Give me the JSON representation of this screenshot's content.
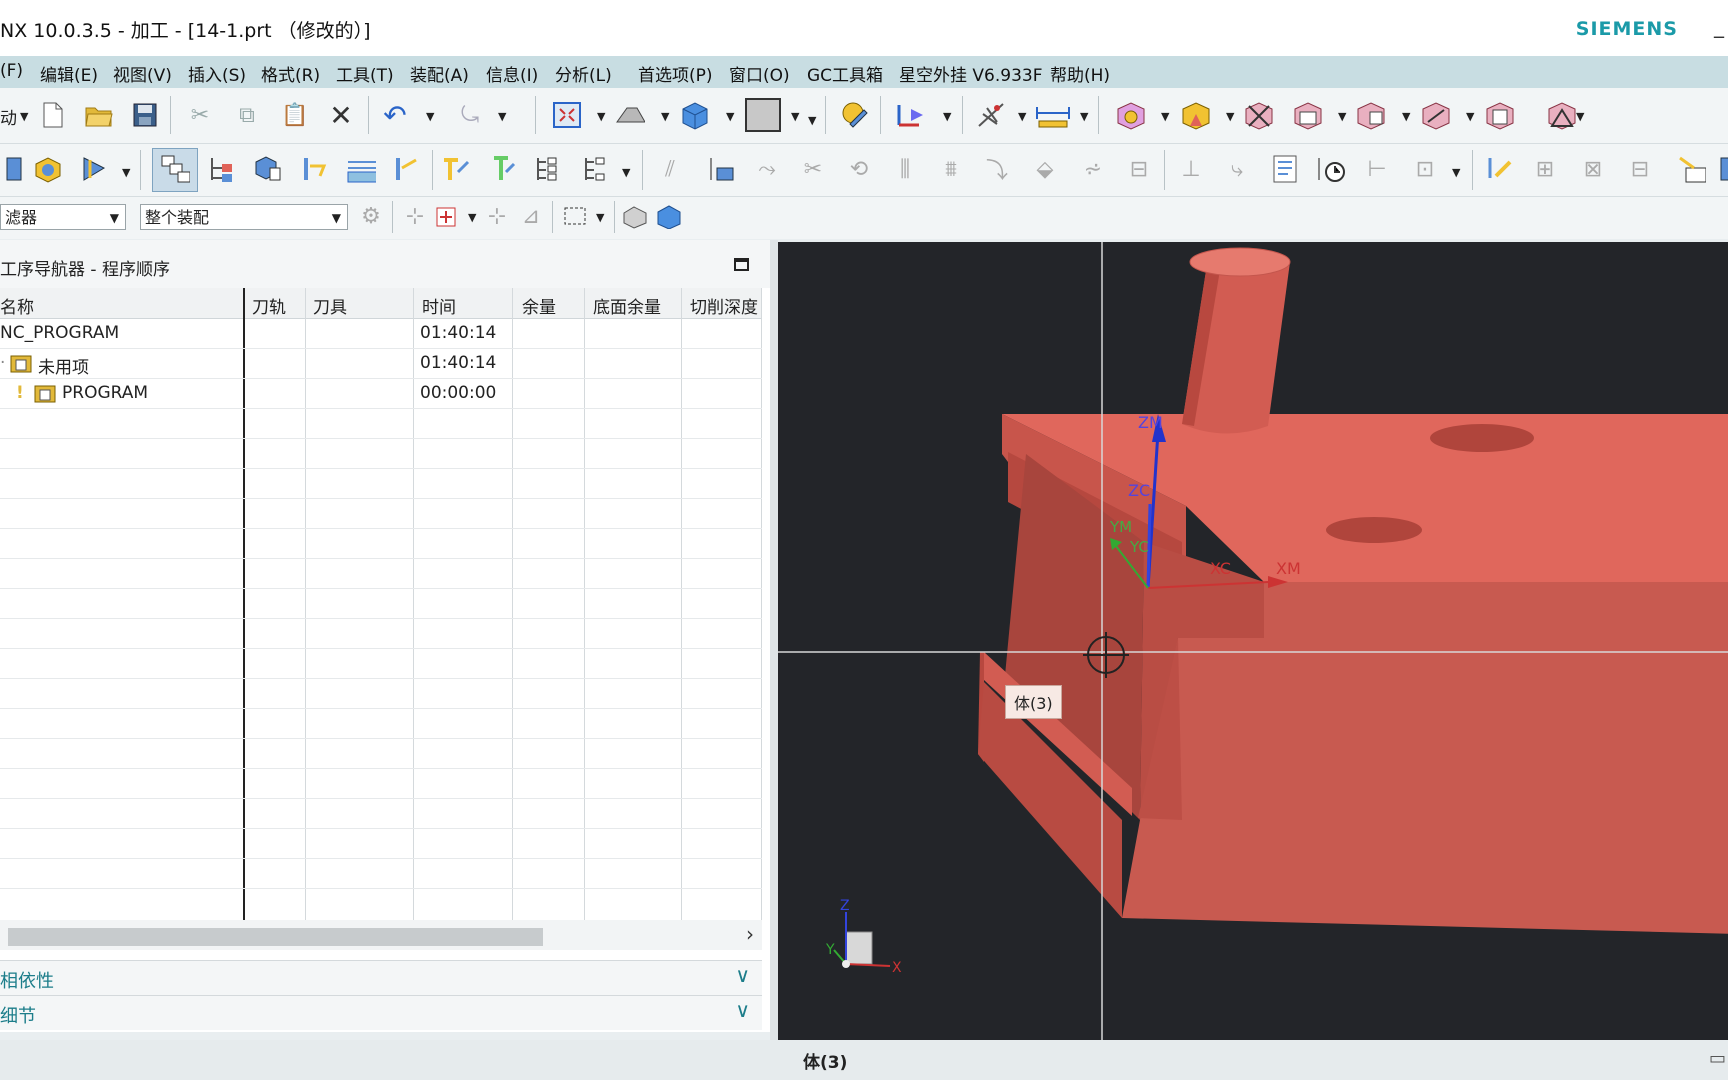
{
  "window": {
    "title": "NX 10.0.3.5 - 加工 - [14-1.prt （修改的）]",
    "brand": "SIEMENS",
    "minimize": "_"
  },
  "menu": [
    "(F)",
    "编辑(E)",
    "视图(V)",
    "插入(S)",
    "格式(R)",
    "工具(T)",
    "装配(A)",
    "信息(I)",
    "分析(L)",
    "首选项(P)",
    "窗口(O)",
    "GC工具箱",
    "星空外挂 V6.933F",
    "帮助(H)"
  ],
  "toolbar1": {
    "first_label": "动",
    "icons": [
      "new-icon",
      "open-icon",
      "save-icon",
      "cut-icon",
      "copy-icon",
      "paste-icon",
      "delete-icon",
      "undo-icon",
      "repeat-icon",
      "fit-view-icon",
      "orient-view-icon",
      "shaded-cube-icon",
      "background-icon",
      "edit-object-display-icon",
      "csys-icon",
      "wcs-icon",
      "measure-distance-icon",
      "create-program-icon",
      "create-tool-icon",
      "create-geometry-icon",
      "create-method-icon",
      "create-operation-icon",
      "part-navigator-icon",
      "assembly-icon"
    ]
  },
  "toolbar2": {
    "icons": [
      "machine-tool-view-icon",
      "program-order-view-icon",
      "tool-view-icon",
      "geometry-view-icon",
      "method-view-icon",
      "generate-toolpath-icon",
      "replay-toolpath-icon",
      "verify-toolpath-icon",
      "list-toolpath-icon",
      "postprocess-icon",
      "shop-docs-icon"
    ]
  },
  "filter_bar": {
    "filter_value": "滤器",
    "assembly_value": "整个装配"
  },
  "navigator": {
    "title": "工序导航器 - 程序顺序",
    "columns": [
      "名称",
      "刀轨",
      "刀具",
      "时间",
      "余量",
      "底面余量",
      "切削深度"
    ],
    "rows": [
      {
        "name": "NC_PROGRAM",
        "time": "01:40:14"
      },
      {
        "name": "未用项",
        "time": "01:40:14"
      },
      {
        "name": "PROGRAM",
        "time": "00:00:00"
      }
    ],
    "sections": [
      "相依性",
      "细节"
    ]
  },
  "viewport": {
    "tooltip": "体(3)",
    "axis_labels": {
      "zm": "ZM",
      "zc": "ZC",
      "ym": "YM",
      "yc": "YC",
      "xc": "XC",
      "xm": "XM"
    },
    "triad": {
      "z": "Z",
      "y": "Y",
      "x": "X"
    },
    "model_color": "#e06258",
    "background_color": "#232529"
  },
  "status": {
    "text": "体(3)"
  }
}
